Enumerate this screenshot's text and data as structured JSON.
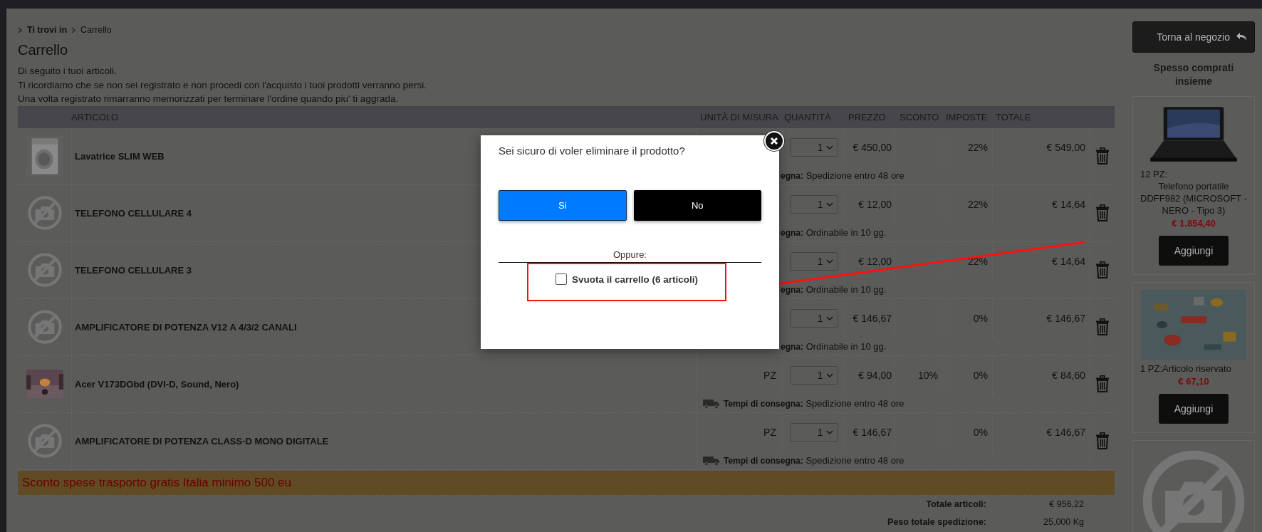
{
  "breadcrumb": {
    "root": "Ti trovi in",
    "current": "Carrello"
  },
  "page_title": "Carrello",
  "intro_lines": [
    "Di seguito i tuoi articoli.",
    "Ti ricordiamo che se non sei registrato e non procedi con l'acquisto i tuoi prodotti verranno persi.",
    "Una volta registrato rimarranno memorizzati per terminare l'ordine quando piu' ti aggrada."
  ],
  "table": {
    "columns": [
      "ARTICOLO",
      "UNITÀ DI MISURA",
      "QUANTITÀ",
      "PREZZO",
      "SCONTO",
      "IMPOSTE",
      "TOTALE"
    ],
    "rows": [
      {
        "name": "Lavatrice SLIM WEB",
        "quantity": "1",
        "price": "€ 450,00",
        "tax": "22%",
        "total": "€ 549,00",
        "delivery": {
          "truck": false,
          "label": "egna:",
          "value": "Spedizione entro 48 ore"
        }
      },
      {
        "thumbnail": {
          "kind": "no_image"
        },
        "name": "TELEFONO CELLULARE 4",
        "quantity": "1",
        "price": "€ 12,00",
        "tax": "22%",
        "total": "€ 14,64",
        "delivery": {
          "truck": false,
          "label": "egna:",
          "value": "Ordinabile in 10 gg."
        }
      },
      {
        "thumbnail": {
          "kind": "no_image"
        },
        "name": "TELEFONO CELLULARE 3",
        "quantity": "1",
        "price": "€ 12,00",
        "tax": "22%",
        "total": "€ 14,64",
        "delivery": {
          "truck": false,
          "label": "egna:",
          "value": "Ordinabile in 10 gg."
        }
      },
      {
        "thumbnail": {
          "kind": "no_image"
        },
        "name": "AMPLIFICATORE DI POTENZA V12 A 4/3/2 CANALI",
        "quantity": "1",
        "price": "€ 146,67",
        "tax": "0%",
        "total": "€ 146,67",
        "delivery": {
          "truck": false,
          "label": "egna:",
          "value": "Ordinabile in 10 gg."
        }
      },
      {
        "name": "Acer V173DObd (DVI-D, Sound, Nero)",
        "unit": "PZ",
        "quantity": "1",
        "price": "€ 94,00",
        "discount": "10%",
        "tax": "0%",
        "total": "€ 84,60",
        "delivery": {
          "truck": true,
          "label": "Tempi di consegna:",
          "value": "Spedizione entro 48 ore"
        }
      },
      {
        "thumbnail": {
          "kind": "no_image"
        },
        "name": "AMPLIFICATORE DI POTENZA CLASS-D MONO DIGITALE",
        "unit": "PZ",
        "quantity": "1",
        "price": "€ 146,67",
        "tax": "0%",
        "total": "€ 146,67",
        "delivery": {
          "truck": true,
          "label": "Tempi di consegna:",
          "value": "Spedizione entro 48 ore"
        }
      }
    ]
  },
  "promo_banner": "Sconto spese trasporto gratis Italia minimo 500 eu",
  "totals": [
    {
      "label": "Totale articoli:",
      "value": "€ 956,22"
    },
    {
      "label": "Peso totale spedizione:",
      "value": "25,000 Kg"
    }
  ],
  "sidebar": {
    "back_button": "Torna al negozio",
    "title": "Spesso comprati insieme",
    "products": [
      {
        "quantity": "12 PZ:",
        "name": "Telefono portatile DDFF982 (MICROSOFT - NERO - Tipo 3)",
        "price": "€ 1.854,40",
        "button": "Aggiungi"
      },
      {
        "quantity": "1 PZ:",
        "name": "Articolo riservato",
        "price": "€ 67,10",
        "button": "Aggiungi"
      },
      {
        "thumbnail": {
          "kind": "no_image"
        }
      }
    ]
  },
  "modal": {
    "question": "Sei sicuro di voler eliminare il prodotto?",
    "buttons": [
      {
        "label": "Si",
        "kind": "primary"
      },
      {
        "label": "No",
        "kind": "secondary"
      }
    ],
    "separator_label": "Oppure:",
    "empty_cart": {
      "label": "Svuota il carrello (6 articoli)",
      "checked": false,
      "highlighted": true
    }
  }
}
